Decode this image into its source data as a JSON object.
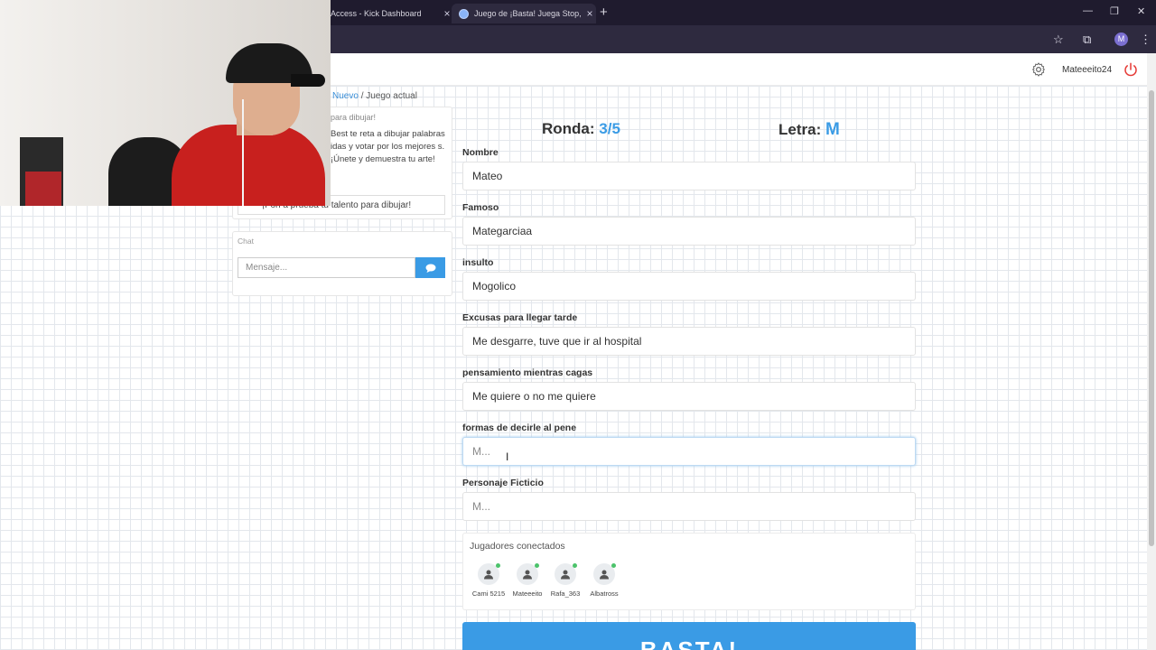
{
  "browser": {
    "tabs": [
      {
        "title": "Access - Kick Dashboard",
        "close": "×"
      },
      {
        "title": "Juego de ¡Basta! Juega Stop, Tu",
        "close": "×"
      }
    ],
    "new_tab": "+",
    "window_controls": [
      "—",
      "❐",
      "✕"
    ],
    "profile_initial": "M"
  },
  "header": {
    "username": "Mateeeito24",
    "icons": [
      "gear-icon",
      "power-icon"
    ],
    "power_color": "#e53935"
  },
  "breadcrumb": {
    "link": "Nuevo",
    "separator": "/",
    "current": "Juego actual"
  },
  "sidebar": {
    "info_title": "para dibujar!",
    "info_text": "Best te reta a dibujar palabras idas y votar por los mejores s. ¡Únete y demuestra tu arte!",
    "challenge": "¡r on a prueba tu talento para dibujar!",
    "chat": {
      "title": "Chat",
      "placeholder": "Mensaje..."
    }
  },
  "game": {
    "round_label": "Ronda:",
    "round_value": "3/5",
    "letter_label": "Letra:",
    "letter_value": "M",
    "accent": "#3a9be5",
    "fields": [
      {
        "label": "Nombre",
        "value": "Mateo",
        "placeholder": "M..."
      },
      {
        "label": "Famoso",
        "value": "Mategarciaa",
        "placeholder": "M..."
      },
      {
        "label": "insulto",
        "value": "Mogolico",
        "placeholder": "M..."
      },
      {
        "label": "Excusas para llegar tarde",
        "value": "Me desgarre, tuve que ir al hospital",
        "placeholder": "M..."
      },
      {
        "label": "pensamiento mientras cagas",
        "value": "Me quiere o no me quiere",
        "placeholder": "M..."
      },
      {
        "label": "formas de decirle al pene",
        "value": "",
        "placeholder": "M..."
      },
      {
        "label": "Personaje Ficticio",
        "value": "",
        "placeholder": "M..."
      }
    ],
    "players_title": "Jugadores conectados",
    "players": [
      "Cami 5215",
      "Mateeeito",
      "Rafa_363",
      "Albatross"
    ],
    "submit_label": "BASTA!"
  }
}
